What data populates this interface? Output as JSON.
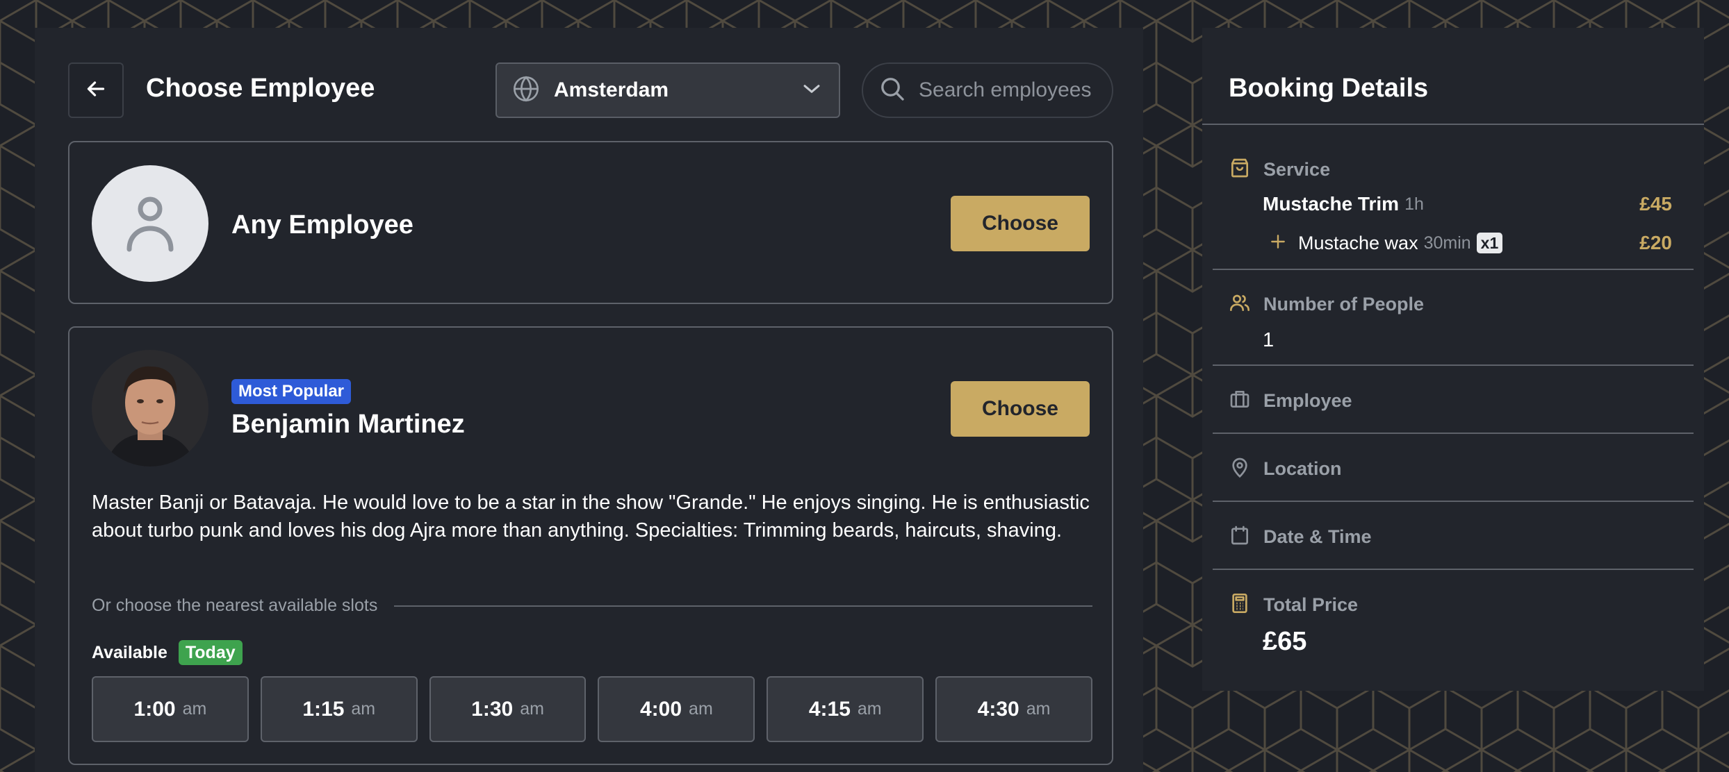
{
  "header": {
    "title": "Choose Employee",
    "location": "Amsterdam",
    "search_placeholder": "Search employees"
  },
  "any_employee": {
    "name": "Any Employee",
    "choose_label": "Choose"
  },
  "employee": {
    "badge": "Most Popular",
    "name": "Benjamin Martinez",
    "choose_label": "Choose",
    "bio": "Master Banji or Batavaja. He would love to be a star in the show \"Grande.\" He enjoys singing. He is enthusiastic about turbo punk and loves his dog Ajra more than anything. Specialties: Trimming beards, haircuts, shaving.",
    "slots_hint": "Or choose the nearest available slots",
    "available_label": "Available",
    "today_label": "Today",
    "slots": [
      {
        "time": "1:00",
        "period": "am"
      },
      {
        "time": "1:15",
        "period": "am"
      },
      {
        "time": "1:30",
        "period": "am"
      },
      {
        "time": "4:00",
        "period": "am"
      },
      {
        "time": "4:15",
        "period": "am"
      },
      {
        "time": "4:30",
        "period": "am"
      }
    ]
  },
  "booking": {
    "title": "Booking Details",
    "service_label": "Service",
    "service": {
      "name": "Mustache Trim",
      "duration": "1h",
      "price": "£45"
    },
    "addon": {
      "name": "Mustache wax",
      "duration": "30min",
      "qty": "x1",
      "price": "£20"
    },
    "people_label": "Number of People",
    "people_value": "1",
    "employee_label": "Employee",
    "location_label": "Location",
    "datetime_label": "Date & Time",
    "total_label": "Total Price",
    "total_value": "£65"
  },
  "colors": {
    "background": "#1d2027",
    "panel": "#22252c",
    "accent_gold": "#c9aa63",
    "badge_blue": "#2e5bd8",
    "badge_green": "#3ea34e"
  },
  "icons": [
    "arrow-left-icon",
    "globe-icon",
    "chevron-down-icon",
    "search-icon",
    "user-icon",
    "shopping-bag-icon",
    "plus-icon",
    "users-icon",
    "briefcase-icon",
    "map-pin-icon",
    "calendar-icon",
    "calculator-icon"
  ]
}
